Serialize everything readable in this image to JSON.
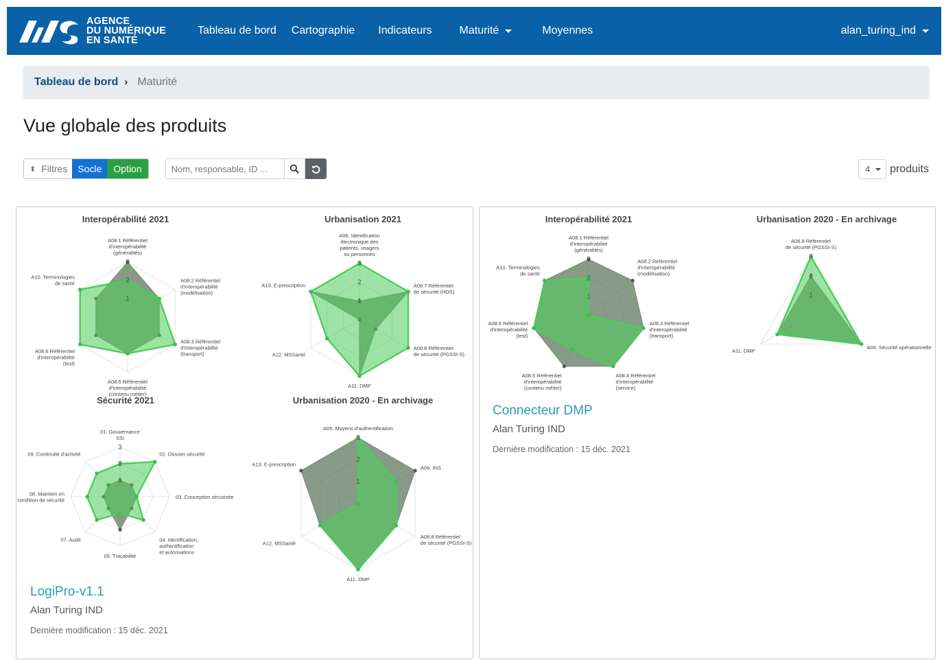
{
  "brand": {
    "line1": "AGENCE",
    "line2": "DU NUMÉRIQUE",
    "line3": "EN SANTÉ"
  },
  "nav": {
    "items": [
      {
        "label": "Tableau de bord"
      },
      {
        "label": "Cartographie"
      },
      {
        "label": "Indicateurs"
      },
      {
        "label": "Maturité"
      },
      {
        "label": "Moyennes"
      }
    ],
    "user": "alan_turing_ind"
  },
  "breadcrumb": {
    "home": "Tableau de bord",
    "current": "Maturité"
  },
  "page": {
    "title": "Vue globale des produits"
  },
  "toolbar": {
    "filters_label": "Filtres",
    "socle_label": "Socle",
    "option_label": "Option",
    "search_placeholder": "Nom, responsable, ID ...",
    "count_value": "4",
    "count_label": "produits"
  },
  "colors": {
    "navbar": "#0b61a8",
    "socle": "#1271d3",
    "option": "#2aa042",
    "radar_option": "#4ccd5a",
    "radar_socle": "#5f7a5f",
    "link": "#2a9db8"
  },
  "products": [
    {
      "name": "LogiPro-v1.1",
      "owner": "Alan Turing IND",
      "modified": "Dernière modification : 15 déc. 2021",
      "charts": [
        {
          "title": "Interopérabilité 2021",
          "max": 3,
          "ticks": [
            "1",
            "2",
            "3"
          ],
          "axes": [
            "A08.1 Référentiel|d'interopérabilité|(généralités)",
            "A08.2 Référentiel|d'interopérabilité|(modélisation)",
            "A08.3 Référentiel|d'interopérabilité|(transport)",
            "A08.5 Référentiel|d'interopérabilité|(contenu métier)",
            "A08.6 Référentiel|d'interopérabilité|(test)",
            "A10. Terminologies|de santé"
          ],
          "socle": [
            3,
            2,
            2,
            2,
            2,
            2
          ],
          "option": [
            2,
            2,
            3,
            2,
            3,
            3
          ]
        },
        {
          "title": "Urbanisation 2021",
          "max": 3,
          "ticks": [
            "1",
            "2",
            "3"
          ],
          "axes": [
            "A06. Identification|électronique des|patients, usagers|ou personnes",
            "A08.7 Référentiel|de sécurité (HDS)",
            "A08.8 Référentiel|de sécurité (PGSSI-S)",
            "A11. DMP",
            "A12. MSSanté",
            "A13. E-prescription"
          ],
          "socle": [
            1,
            3,
            1,
            3,
            0,
            3
          ],
          "option": [
            3,
            3,
            3,
            3,
            2,
            3
          ]
        },
        {
          "title": "Sécurité 2021",
          "max": 3,
          "ticks": [
            "1",
            "2",
            "3"
          ],
          "axes": [
            "01. Gouvernance|SSI",
            "02. Dossier sécurité",
            "03. Conception sécurisée",
            "04. Identification,|authentification|et autorisations",
            "05. Traçabilité",
            "07. Audit",
            "08. Maintien en|condition de sécurité",
            "09. Continuité d'activité"
          ],
          "socle": [
            1,
            1,
            1,
            1,
            2,
            1,
            1,
            1
          ],
          "option": [
            2,
            3,
            1,
            2,
            1,
            2,
            2,
            2
          ]
        },
        {
          "title": "Urbanisation 2020 - En archivage",
          "max": 3,
          "ticks": [
            "1",
            "2",
            "3"
          ],
          "axes": [
            "A05. Moyens d'authentification",
            "A06. INS",
            "A08.8 Référentiel|de sécurité (PGSSI-S)",
            "A11. DMP",
            "A12. MSSanté",
            "A13. E-prescription"
          ],
          "socle": [
            3,
            3,
            2,
            3,
            2,
            3
          ],
          "option": [
            3,
            2,
            2,
            3,
            2,
            0
          ]
        }
      ]
    },
    {
      "name": "Connecteur DMP",
      "owner": "Alan Turing IND",
      "modified": "Dernière modification : 15 déc. 2021",
      "charts": [
        {
          "title": "Interopérabilité 2021",
          "max": 3,
          "ticks": [
            "1",
            "2",
            "3"
          ],
          "axes": [
            "A08.1 Référentiel|d'interopérabilité|(généralités)",
            "A08.2 Référentiel|d'interopérabilité|(modélisation)",
            "A08.3 Référentiel|d'interopérabilité|(transport)",
            "A08.4 Référentiel|d'interopérabilité|(service)",
            "A08.5 Référentiel|d'interopérabilité|(contenu métier)",
            "A08.6 Référentiel|d'interopérabilité|(test)",
            "A10. Terminologies|de santé"
          ],
          "socle": [
            3,
            3,
            3,
            3,
            3,
            3,
            3
          ],
          "option": [
            2,
            0,
            3,
            3,
            2,
            3,
            3
          ]
        },
        {
          "title": "Urbanisation 2020 - En archivage",
          "max": 3,
          "ticks": [
            "1",
            "2",
            "3"
          ],
          "axes": [
            "A08.8 Référentiel|de sécurité (PGSSI-S)",
            "A09. Sécurité opérationnelle",
            "A11. DMP"
          ],
          "socle": [
            2,
            3,
            2
          ],
          "option": [
            3,
            3,
            2
          ]
        }
      ]
    }
  ]
}
